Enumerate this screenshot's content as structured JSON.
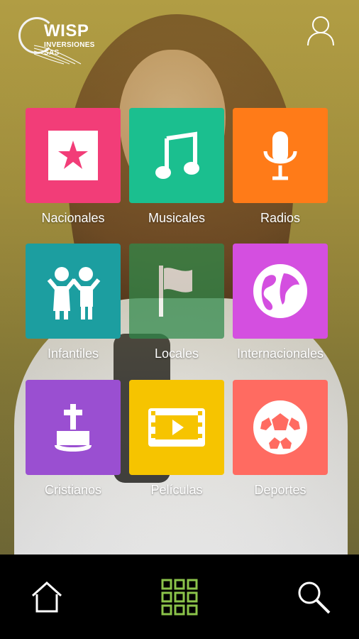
{
  "brand": {
    "logo_main": "WISP",
    "logo_sub": "INVERSIONES SAS"
  },
  "categories": [
    {
      "label": "Nacionales",
      "color": "#f23d78",
      "icon": "star-icon"
    },
    {
      "label": "Musicales",
      "color": "#1bbf8f",
      "icon": "music-note-icon"
    },
    {
      "label": "Radios",
      "color": "#ff7b18",
      "icon": "microphone-icon"
    },
    {
      "label": "Infantiles",
      "color": "#1c9ea0",
      "icon": "children-icon"
    },
    {
      "label": "Locales",
      "color": "#2f8a4b",
      "icon": "flag-icon"
    },
    {
      "label": "Internacionales",
      "color": "#d44fe0",
      "icon": "globe-icon"
    },
    {
      "label": "Cristianos",
      "color": "#9a4fd1",
      "icon": "cross-bible-icon"
    },
    {
      "label": "Películas",
      "color": "#f6c400",
      "icon": "film-icon"
    },
    {
      "label": "Deportes",
      "color": "#ff6b61",
      "icon": "soccer-ball-icon"
    }
  ],
  "nav": {
    "home_icon": "home-icon",
    "grid_icon": "grid-icon",
    "search_icon": "search-icon",
    "active_color": "#8bc34a"
  }
}
